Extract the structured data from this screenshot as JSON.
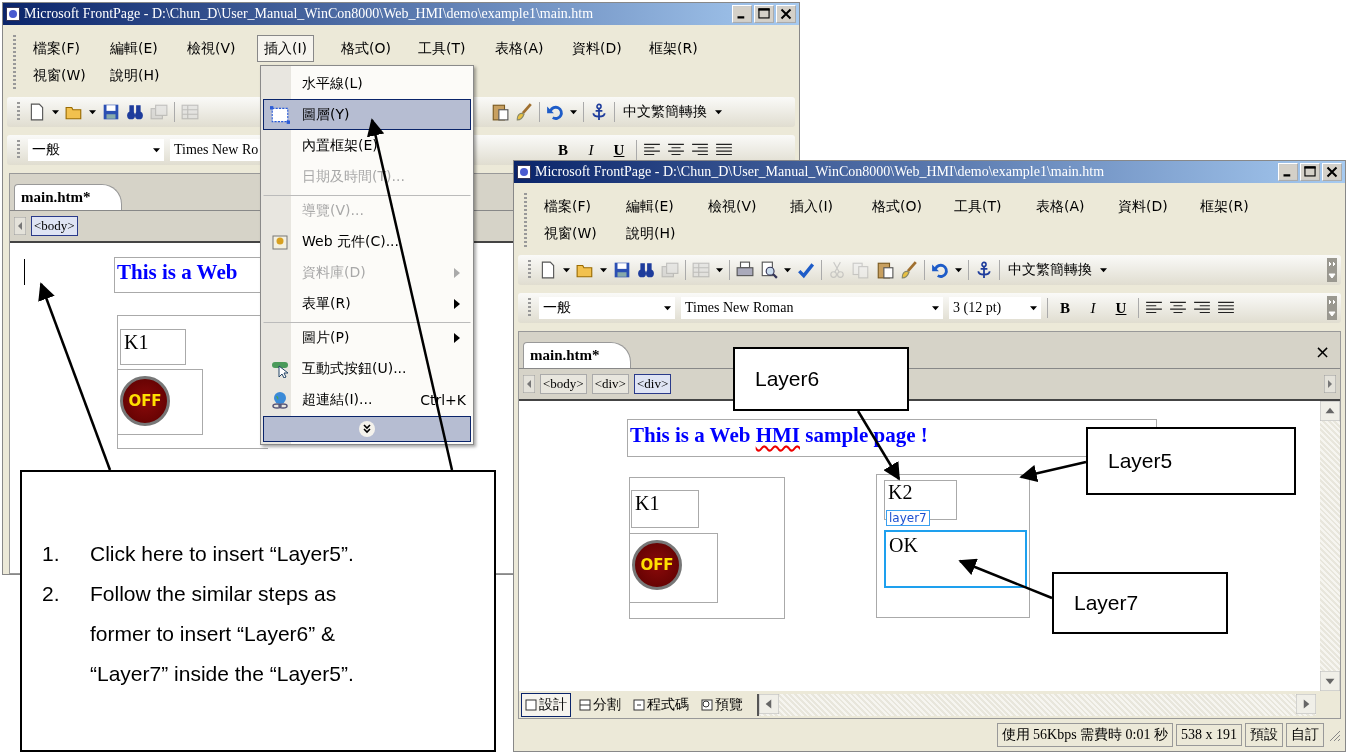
{
  "back_window": {
    "title": "Microsoft FrontPage - D:\\Chun_D\\User_Manual_WinCon8000\\Web_HMI\\demo\\example1\\main.htm",
    "menu": [
      {
        "label": "檔案(F)",
        "selected": false
      },
      {
        "label": "編輯(E)",
        "selected": false
      },
      {
        "label": "檢視(V)",
        "selected": false
      },
      {
        "label": "插入(I)",
        "selected": true
      },
      {
        "label": "格式(O)",
        "selected": false
      },
      {
        "label": "工具(T)",
        "selected": false
      },
      {
        "label": "表格(A)",
        "selected": false
      },
      {
        "label": "資料(D)",
        "selected": false
      },
      {
        "label": "框架(R)",
        "selected": false
      },
      {
        "label": "視窗(W)",
        "selected": false
      },
      {
        "label": "說明(H)",
        "selected": false
      }
    ],
    "convert_button": "中文繁簡轉換",
    "style_combo": "一般",
    "font_combo": "Times New Ro",
    "format_buttons": [
      "B",
      "I",
      "U"
    ],
    "tab": "main.htm*",
    "breadcrumbs": [
      {
        "label": "<body>",
        "selected": true
      }
    ],
    "page": {
      "heading": "This is a Web",
      "label": "K1",
      "button": "OFF"
    }
  },
  "insert_menu": {
    "items": [
      {
        "label": "水平線(L)",
        "selected": false,
        "disabled": false,
        "submenu": false,
        "separator_before": false
      },
      {
        "label": "圖層(Y)",
        "selected": true,
        "disabled": false,
        "submenu": false,
        "separator_before": false
      },
      {
        "label": "內置框架(E)",
        "selected": false,
        "disabled": false,
        "submenu": false,
        "separator_before": false
      },
      {
        "label": "日期及時間(T)...",
        "selected": false,
        "disabled": true,
        "submenu": false,
        "separator_before": false
      },
      {
        "label": "導覽(V)...",
        "selected": false,
        "disabled": true,
        "submenu": false,
        "separator_before": true
      },
      {
        "label": "Web 元件(C)...",
        "selected": false,
        "disabled": false,
        "submenu": false,
        "separator_before": false
      },
      {
        "label": "資料庫(D)",
        "selected": false,
        "disabled": true,
        "submenu": true,
        "separator_before": false
      },
      {
        "label": "表單(R)",
        "selected": false,
        "disabled": false,
        "submenu": true,
        "separator_before": false
      },
      {
        "label": "圖片(P)",
        "selected": false,
        "disabled": false,
        "submenu": true,
        "separator_before": true
      },
      {
        "label": "互動式按鈕(U)...",
        "selected": false,
        "disabled": false,
        "submenu": false,
        "separator_before": false
      },
      {
        "label": "超連結(I)...",
        "shortcut": "Ctrl+K",
        "selected": false,
        "disabled": false,
        "submenu": false,
        "separator_before": false
      }
    ]
  },
  "front_window": {
    "title": "Microsoft FrontPage - D:\\Chun_D\\User_Manual_WinCon8000\\Web_HMI\\demo\\example1\\main.htm",
    "menu": [
      {
        "label": "檔案(F)",
        "selected": false
      },
      {
        "label": "編輯(E)",
        "selected": false
      },
      {
        "label": "檢視(V)",
        "selected": false
      },
      {
        "label": "插入(I)",
        "selected": false
      },
      {
        "label": "格式(O)",
        "selected": false
      },
      {
        "label": "工具(T)",
        "selected": false
      },
      {
        "label": "表格(A)",
        "selected": false
      },
      {
        "label": "資料(D)",
        "selected": false
      },
      {
        "label": "框架(R)",
        "selected": false
      },
      {
        "label": "視窗(W)",
        "selected": false
      },
      {
        "label": "說明(H)",
        "selected": false
      }
    ],
    "convert_button": "中文繁簡轉換",
    "style_combo": "一般",
    "font_combo": "Times New Roman",
    "size_combo": "3  (12 pt)",
    "format_buttons": [
      "B",
      "I",
      "U"
    ],
    "tab": "main.htm*",
    "close": "×",
    "breadcrumbs": [
      {
        "label": "<body>",
        "selected": false
      },
      {
        "label": "<div>",
        "selected": false
      },
      {
        "label": "<div>",
        "selected": true
      }
    ],
    "page": {
      "heading": {
        "before": "This is a Web ",
        "flagged": "HMI",
        "after": " sample page !"
      },
      "label_1": "K1",
      "button": "OFF",
      "label_2": "K2",
      "layer_tag": "layer7",
      "selected_layer": "OK"
    },
    "view_tabs": [
      {
        "label": "設計",
        "selected": true
      },
      {
        "label": "分割",
        "selected": false
      },
      {
        "label": "程式碼",
        "selected": false
      },
      {
        "label": "預覽",
        "selected": false
      }
    ],
    "status_bar": [
      "使用 56Kbps 需費時 0:01 秒",
      "538 x 191",
      "預設",
      "自訂"
    ]
  },
  "callouts": {
    "instructions": [
      {
        "number": "1.",
        "text": "Click here to insert “Layer5”."
      },
      {
        "number": "2.",
        "text": "Follow the similar steps as former to insert “Layer6” & “Layer7” inside the “Layer5”."
      }
    ],
    "labels": [
      "Layer6",
      "Layer5",
      "Layer7"
    ]
  }
}
